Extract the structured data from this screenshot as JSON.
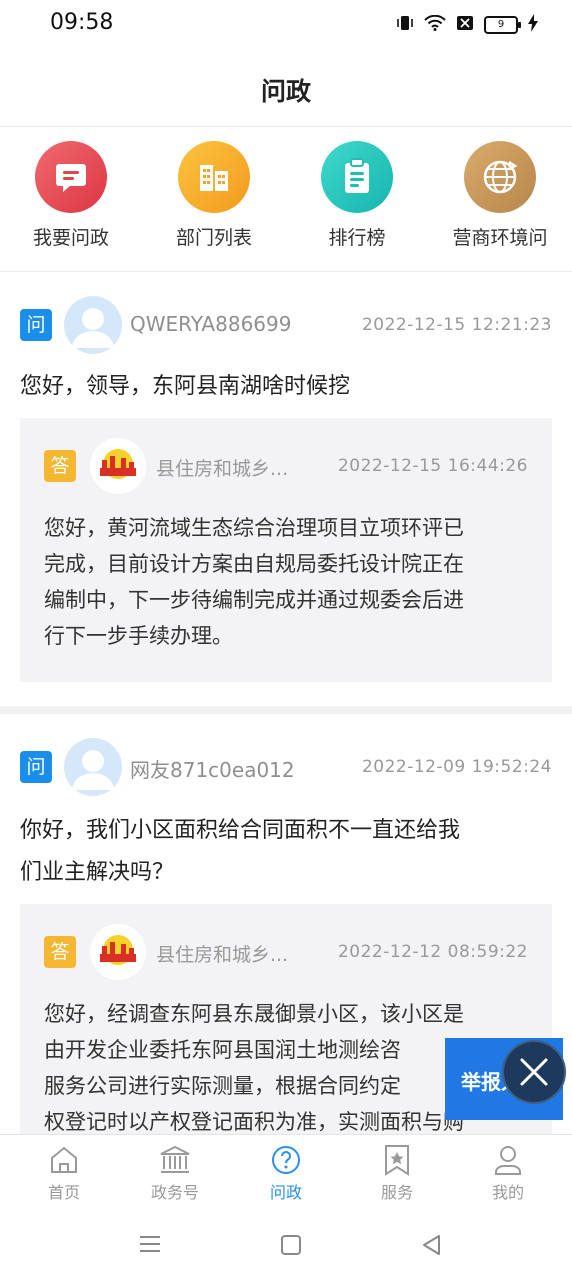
{
  "status": {
    "time": "09:58",
    "battery": "9"
  },
  "header": {
    "title": "问政"
  },
  "quick_nav": [
    {
      "label": "我要问政",
      "icon": "message-icon",
      "color": "#e8474f"
    },
    {
      "label": "部门列表",
      "icon": "building-icon",
      "color": "#f7a928"
    },
    {
      "label": "排行榜",
      "icon": "clipboard-icon",
      "color": "#25c7be"
    },
    {
      "label": "营商环境问",
      "icon": "globe-icon",
      "color": "#c99859"
    }
  ],
  "posts": [
    {
      "badge_q": "问",
      "user": "QWERYA886699",
      "time": "2022-12-15 12:21:23",
      "question": "您好，领导，东阿县南湖啥时候挖",
      "answer": {
        "badge_a": "答",
        "dept": "县住房和城乡...",
        "time": "2022-12-15 16:44:26",
        "lines": [
          "您好，黄河流域生态综合治理项目立项环评已",
          "完成，目前设计方案由自规局委托设计院正在",
          "编制中，下一步待编制完成并通过规委会后进",
          "行下一步手续办理。"
        ]
      }
    },
    {
      "badge_q": "问",
      "user": "网友871c0ea012",
      "time": "2022-12-09 19:52:24",
      "question_lines": [
        "你好，我们小区面积给合同面积不一直还给我",
        "们业主解决吗？"
      ],
      "answer": {
        "badge_a": "答",
        "dept": "县住房和城乡...",
        "time": "2022-12-12 08:59:22",
        "lines": [
          "您好，经调查东阿县东晟御景小区，该小区是",
          "由开发企业委托东阿县国润土地测绘咨",
          "服务公司进行实际测量，根据合同约定",
          "权登记时以产权登记面积为准，实测面积与购"
        ]
      }
    }
  ],
  "report_float": {
    "label": "举报入口"
  },
  "tabbar": [
    {
      "label": "首页",
      "icon": "home-icon",
      "active": false
    },
    {
      "label": "政务号",
      "icon": "government-icon",
      "active": false
    },
    {
      "label": "问政",
      "icon": "question-icon",
      "active": true
    },
    {
      "label": "服务",
      "icon": "bookmark-star-icon",
      "active": false
    },
    {
      "label": "我的",
      "icon": "user-icon",
      "active": false
    }
  ],
  "colors": {
    "accent": "#2b8ef0",
    "q_badge": "#1a8ee8",
    "a_badge": "#f5b731"
  }
}
